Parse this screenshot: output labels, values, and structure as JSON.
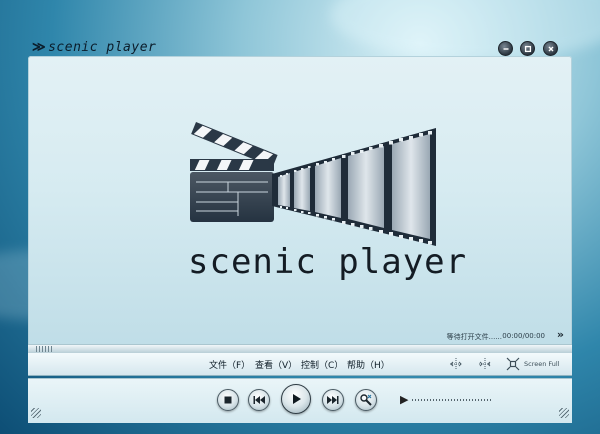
{
  "app": {
    "title": "scenic player",
    "logo_text": "scenic player"
  },
  "window_controls": [
    {
      "name": "minimize-button",
      "icon": "minimize-icon"
    },
    {
      "name": "maximize-button",
      "icon": "maximize-icon"
    },
    {
      "name": "close-button",
      "icon": "close-icon"
    }
  ],
  "status": {
    "message": "等待打开文件......",
    "time": "00:00/00:00"
  },
  "playback": {
    "progress_fraction": 0
  },
  "menu": {
    "file": "文件（F）",
    "view": "查看（V）",
    "control": "控制（C）",
    "help": "帮助（H）"
  },
  "toolbar": {
    "screen_full_label": "Screen Full",
    "icons": [
      "shrink-view-icon",
      "expand-view-icon",
      "screen-full-icon"
    ]
  },
  "controls": {
    "buttons": [
      "stop-icon",
      "previous-icon",
      "play-icon",
      "next-icon",
      "settings-icon"
    ],
    "volume_level": 0
  },
  "colors": {
    "accent": "#2f86ab",
    "text": "#0e1d27"
  }
}
